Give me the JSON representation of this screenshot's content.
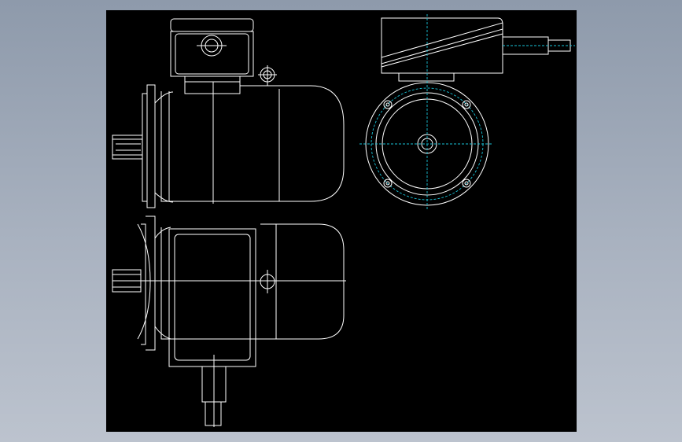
{
  "viewer": {
    "background": "#000000",
    "line_color": "#ffffff",
    "centerline_color": "#19c3d8"
  },
  "views": [
    {
      "id": "front-view",
      "icon": "motor-side-elevation-drawing"
    },
    {
      "id": "end-view",
      "icon": "motor-flange-end-drawing"
    },
    {
      "id": "top-view",
      "icon": "motor-plan-view-drawing"
    }
  ]
}
